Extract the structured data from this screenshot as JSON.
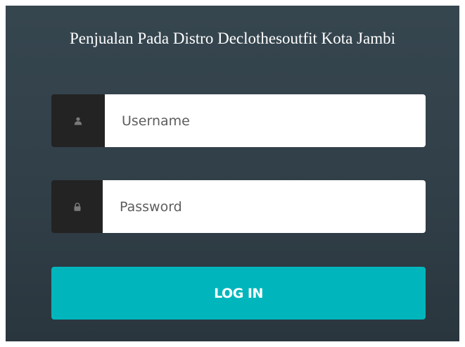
{
  "login": {
    "title": "Penjualan Pada Distro Declothesoutfit Kota Jambi",
    "username": {
      "placeholder": "Username",
      "value": "",
      "icon": "user-icon"
    },
    "password": {
      "placeholder": "Password",
      "value": "",
      "icon": "lock-icon"
    },
    "button_label": "LOG IN"
  },
  "colors": {
    "panel_top": "#36464f",
    "panel_bottom": "#2a363e",
    "icon_box": "#232323",
    "icon": "#7a7a7a",
    "accent": "#00b6bc",
    "input_bg": "#ffffff"
  }
}
